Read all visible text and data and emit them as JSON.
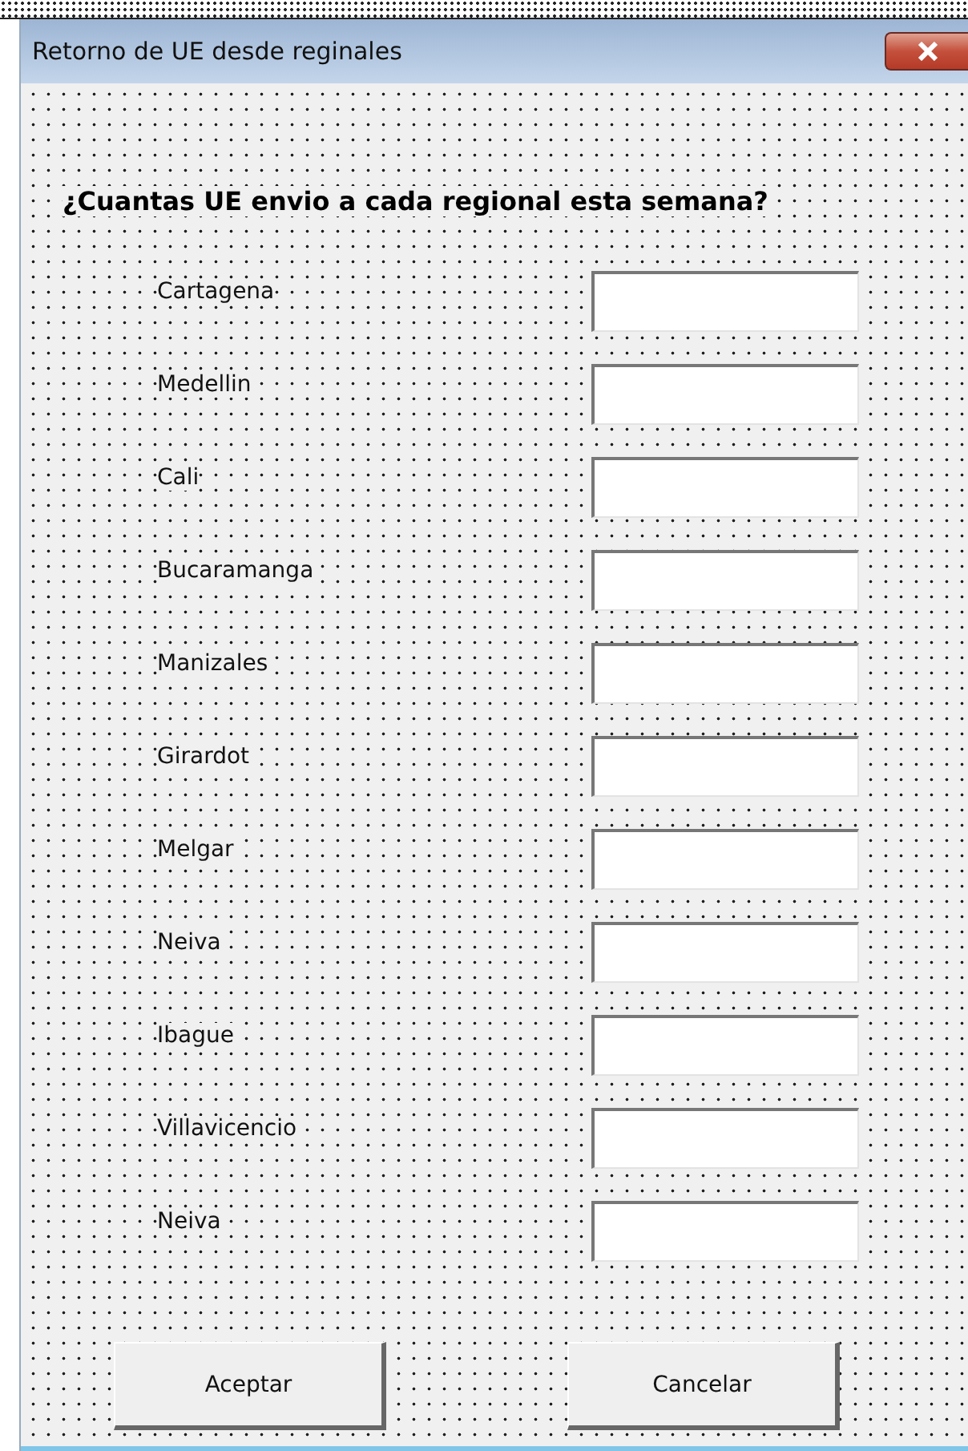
{
  "window": {
    "title": "Retorno de UE desde reginales"
  },
  "question": "¿Cuantas UE envio a cada regional esta semana?",
  "fields": [
    {
      "label": "Cartagena"
    },
    {
      "label": "Medellin"
    },
    {
      "label": "Cali"
    },
    {
      "label": "Bucaramanga"
    },
    {
      "label": "Manizales"
    },
    {
      "label": "Girardot"
    },
    {
      "label": "Melgar"
    },
    {
      "label": "Neiva"
    },
    {
      "label": "Ibague"
    },
    {
      "label": "Villavicencio"
    },
    {
      "label": "Neiva"
    }
  ],
  "buttons": [
    "Aceptar",
    "Cancelar"
  ]
}
